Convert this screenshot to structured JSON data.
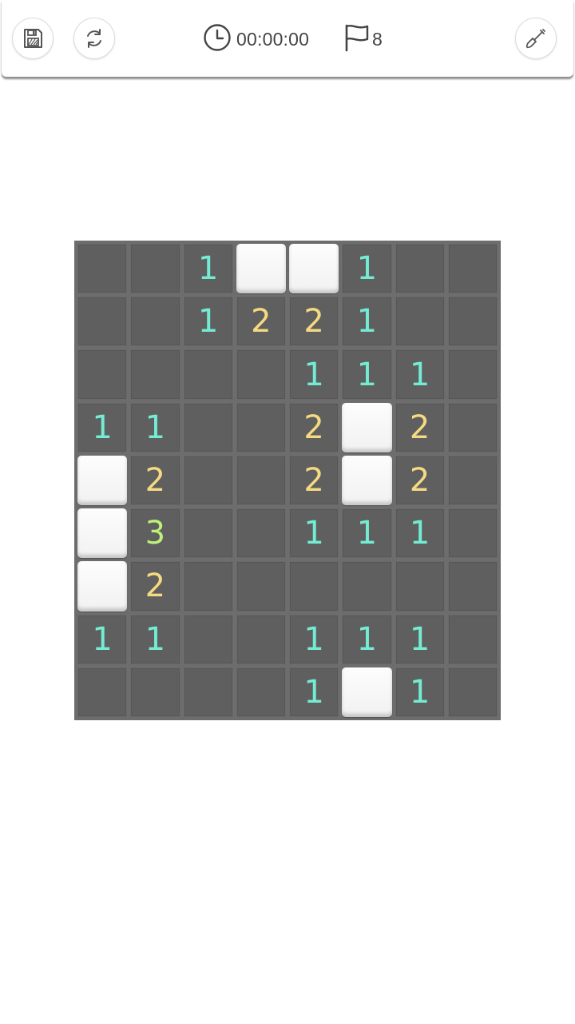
{
  "toolbar": {
    "timer": "00:00:00",
    "flags_remaining": "8"
  },
  "icons": {
    "save": "save-icon",
    "restart": "restart-icon",
    "timer": "clock-icon",
    "flag": "flag-icon",
    "mode": "shovel-icon"
  },
  "colors": {
    "revealed_cell": "#5f5f5f",
    "board_border": "#6d6d6d",
    "covered_cell": "#f7f7f7",
    "number_1": "#74ecd4",
    "number_2": "#f5da82",
    "number_3": "#bdf27a"
  },
  "board": {
    "columns": 8,
    "rows": [
      [
        "",
        "",
        "1",
        "#",
        "#",
        "1",
        "",
        ""
      ],
      [
        "",
        "",
        "1",
        "2",
        "2",
        "1",
        "",
        ""
      ],
      [
        "",
        "",
        "",
        "",
        "1",
        "1",
        "1",
        ""
      ],
      [
        "1",
        "1",
        "",
        "",
        "2",
        "#",
        "2",
        ""
      ],
      [
        "#",
        "2",
        "",
        "",
        "2",
        "#",
        "2",
        ""
      ],
      [
        "#",
        "3",
        "",
        "",
        "1",
        "1",
        "1",
        ""
      ],
      [
        "#",
        "2",
        "",
        "",
        "",
        "",
        "",
        ""
      ],
      [
        "1",
        "1",
        "",
        "",
        "1",
        "1",
        "1",
        ""
      ],
      [
        "",
        "",
        "",
        "",
        "1",
        "#",
        "1",
        ""
      ]
    ]
  }
}
